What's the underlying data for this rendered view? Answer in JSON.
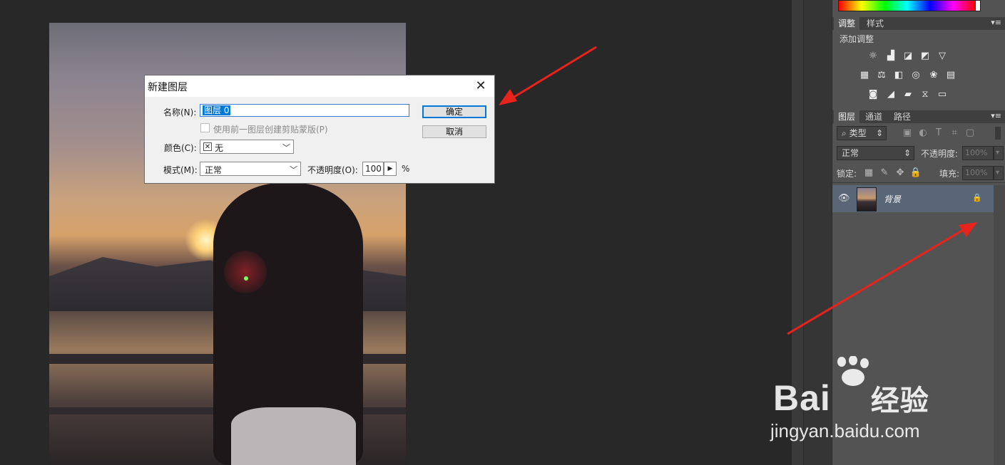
{
  "dialog": {
    "title": "新建图层",
    "name_label": "名称(N):",
    "name_value": "图层 0",
    "clip_label": "使用前一图层创建剪贴蒙版(P)",
    "color_label": "颜色(C):",
    "color_value": "无",
    "mode_label": "模式(M):",
    "mode_value": "正常",
    "opacity_label": "不透明度(O):",
    "opacity_value": "100",
    "opacity_unit": "%",
    "ok": "确定",
    "cancel": "取消"
  },
  "adjust_panel": {
    "tab_active": "调整",
    "tab_other": "样式",
    "add_label": "添加调整"
  },
  "layers_panel": {
    "tabs": [
      "图层",
      "通道",
      "路径"
    ],
    "filter_label": "类型",
    "blend_mode": "正常",
    "opacity_label": "不透明度:",
    "opacity_value": "100%",
    "lock_label": "锁定:",
    "fill_label": "填充:",
    "fill_value": "100%",
    "layer_name": "背景"
  },
  "watermark": {
    "brand": "Bai",
    "brand2": "经验",
    "url": "jingyan.baidu.com"
  },
  "colors": {
    "arrow": "#e8231c",
    "accent": "#0078d7",
    "layer_selected": "#596678"
  }
}
